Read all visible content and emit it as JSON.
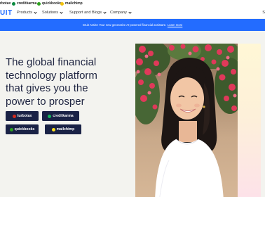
{
  "brandbar": {
    "items": [
      {
        "label": "rbotax",
        "color": "#d52b1e"
      },
      {
        "label": "creditkarma",
        "color": "#0a8a3f"
      },
      {
        "label": "quickbooks",
        "color": "#2ca01c"
      },
      {
        "label": "mailchimp",
        "color": "#f2c10b"
      }
    ]
  },
  "nav": {
    "logo": "UIT",
    "items": [
      {
        "label": "Products"
      },
      {
        "label": "Solutions"
      },
      {
        "label": "Support and Blogs"
      },
      {
        "label": "Company"
      }
    ],
    "right_label": "S"
  },
  "banner": {
    "text": "Intuit Assist: Your new generative AI-powered financial assistant.",
    "link": "Learn more"
  },
  "hero": {
    "headline_lines": [
      "The global financial",
      "technology platform",
      "that gives you the",
      "power to prosper"
    ],
    "products": [
      {
        "label": "turbotax",
        "color": "#d52b1e"
      },
      {
        "label": "creditkarma",
        "color": "#12b75a"
      },
      {
        "label": "quickbooks",
        "color": "#2ca01c"
      },
      {
        "label": "mailchimp",
        "color": "#ffe01b"
      }
    ]
  },
  "colors": {
    "accent": "#236cff",
    "navy": "#1a2246",
    "hero_bg": "#f3f3ef"
  }
}
